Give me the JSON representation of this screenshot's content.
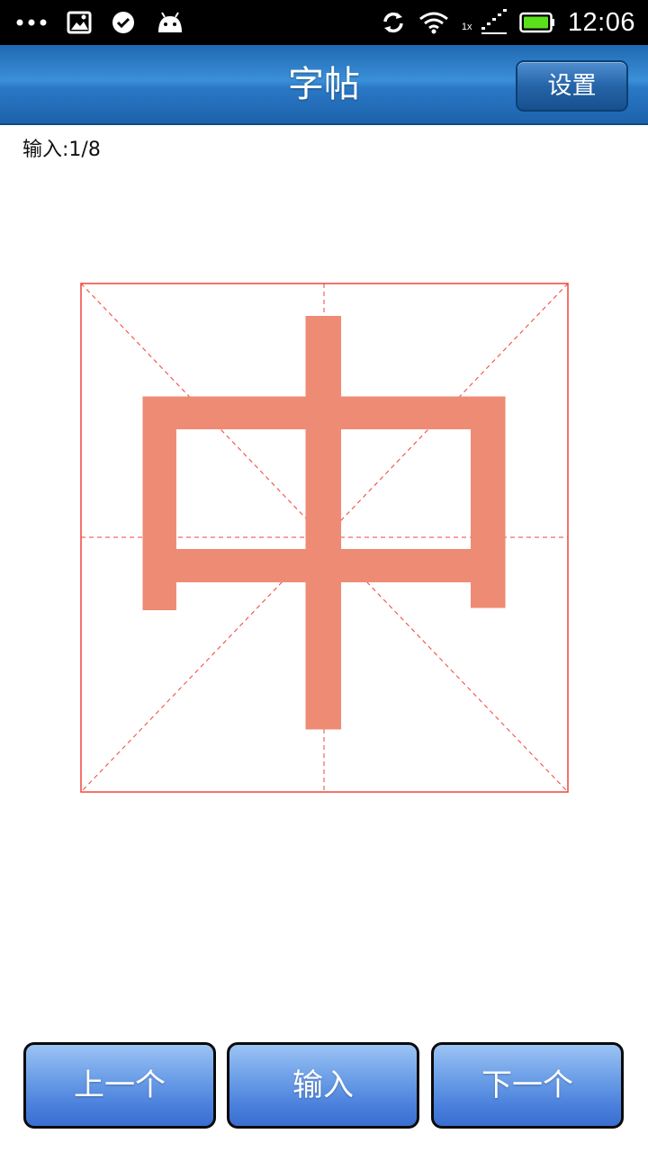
{
  "status_bar": {
    "time": "12:06",
    "left_icons": [
      "more-dots-icon",
      "image-icon",
      "check-circle-icon",
      "android-icon"
    ],
    "right_icons": [
      "sync-icon",
      "wifi-icon",
      "signal-icon",
      "battery-icon"
    ],
    "signal_label": "1x"
  },
  "header": {
    "title": "字帖",
    "settings_label": "设置"
  },
  "counter": {
    "label": "输入: ",
    "value": "1/8"
  },
  "practice": {
    "character": "中",
    "character_color": "#ee8b74",
    "grid_color": "#f2433a"
  },
  "buttons": {
    "prev_label": "上一个",
    "input_label": "输入",
    "next_label": "下一个"
  }
}
